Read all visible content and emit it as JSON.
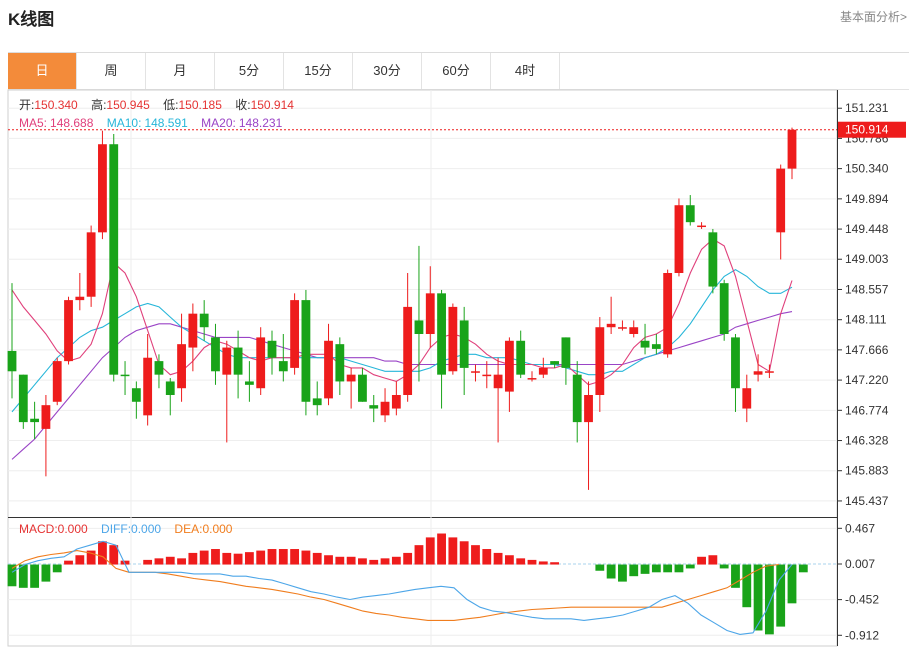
{
  "header": {
    "title": "K线图",
    "link": "基本面分析>"
  },
  "tabs": [
    {
      "label": "日"
    },
    {
      "label": "周"
    },
    {
      "label": "月"
    },
    {
      "label": "5分"
    },
    {
      "label": "15分"
    },
    {
      "label": "30分"
    },
    {
      "label": "60分"
    },
    {
      "label": "4时"
    }
  ],
  "active_tab": "日",
  "info": {
    "open_label": "开:",
    "open": "150.340",
    "high_label": "高:",
    "high": "150.945",
    "low_label": "低:",
    "low": "150.185",
    "close_label": "收:",
    "close": "150.914",
    "ma5_label": "MA5:",
    "ma5": "148.688",
    "ma10_label": "MA10:",
    "ma10": "148.591",
    "ma20_label": "MA20:",
    "ma20": "148.231"
  },
  "macd_info": {
    "macd_label": "MACD:",
    "macd": "0.000",
    "diff_label": "DIFF:",
    "diff": "0.000",
    "dea_label": "DEA:",
    "dea": "0.000"
  },
  "colors": {
    "up": "#ee1c1c",
    "down": "#19a319",
    "ma5": "#e0407b",
    "ma10": "#27b6d9",
    "ma20": "#9a44c6",
    "diff": "#4da6e8",
    "dea": "#f07d1e",
    "accent": "#f38b3a"
  },
  "chart_data": [
    {
      "type": "candlestick",
      "ylim": [
        145.2,
        151.5
      ],
      "y_ticks": [
        "151.231",
        "150.786",
        "150.340",
        "149.894",
        "149.448",
        "149.003",
        "148.557",
        "148.111",
        "147.666",
        "147.220",
        "146.774",
        "146.328",
        "145.883",
        "145.437"
      ],
      "last_price": "150.914",
      "candles": [
        [
          147.65,
          147.35,
          148.65,
          146.95
        ],
        [
          147.3,
          146.6,
          147.3,
          146.5
        ],
        [
          146.65,
          146.6,
          146.9,
          146.35
        ],
        [
          146.5,
          146.85,
          147.0,
          145.8
        ],
        [
          146.9,
          147.5,
          147.55,
          146.85
        ],
        [
          147.5,
          148.4,
          148.45,
          147.45
        ],
        [
          148.4,
          148.45,
          148.8,
          148.25
        ],
        [
          148.45,
          149.4,
          149.5,
          148.3
        ],
        [
          149.4,
          150.7,
          150.9,
          149.3
        ],
        [
          150.7,
          147.3,
          150.85,
          147.2
        ],
        [
          147.3,
          147.28,
          147.5,
          147.0
        ],
        [
          147.1,
          146.9,
          147.2,
          146.65
        ],
        [
          146.7,
          147.55,
          147.9,
          146.55
        ],
        [
          147.5,
          147.3,
          147.6,
          147.1
        ],
        [
          147.2,
          147.0,
          147.25,
          146.7
        ],
        [
          147.1,
          147.75,
          148.2,
          146.9
        ],
        [
          147.7,
          148.2,
          148.35,
          147.35
        ],
        [
          148.2,
          148.0,
          148.4,
          147.8
        ],
        [
          147.85,
          147.35,
          148.05,
          147.15
        ],
        [
          147.3,
          147.7,
          147.8,
          146.3
        ],
        [
          147.7,
          147.3,
          147.95,
          146.95
        ],
        [
          147.2,
          147.15,
          147.5,
          146.9
        ],
        [
          147.1,
          147.85,
          148.0,
          147.0
        ],
        [
          147.8,
          147.55,
          147.95,
          147.3
        ],
        [
          147.5,
          147.35,
          147.9,
          147.2
        ],
        [
          147.4,
          148.4,
          148.5,
          147.3
        ],
        [
          148.4,
          146.9,
          148.55,
          146.7
        ],
        [
          146.95,
          146.85,
          147.2,
          146.7
        ],
        [
          146.95,
          147.8,
          148.05,
          146.85
        ],
        [
          147.75,
          147.2,
          147.85,
          147.0
        ],
        [
          147.2,
          147.3,
          147.4,
          146.8
        ],
        [
          147.3,
          146.9,
          147.4,
          146.9
        ],
        [
          146.85,
          146.8,
          147.0,
          146.6
        ],
        [
          146.7,
          146.9,
          147.1,
          146.6
        ],
        [
          146.8,
          147.0,
          147.2,
          146.7
        ],
        [
          147.0,
          148.3,
          148.8,
          146.9
        ],
        [
          148.1,
          147.9,
          149.2,
          147.2
        ],
        [
          147.9,
          148.5,
          148.9,
          147.7
        ],
        [
          148.5,
          147.3,
          148.55,
          146.8
        ],
        [
          147.35,
          148.3,
          148.35,
          147.3
        ],
        [
          148.1,
          147.4,
          148.3,
          147.0
        ],
        [
          147.35,
          147.35,
          147.45,
          147.2
        ],
        [
          147.3,
          147.3,
          147.5,
          147.1
        ],
        [
          147.1,
          147.3,
          147.55,
          146.3
        ],
        [
          147.05,
          147.8,
          147.85,
          146.75
        ],
        [
          147.8,
          147.3,
          147.95,
          147.25
        ],
        [
          147.25,
          147.25,
          147.35,
          147.2
        ],
        [
          147.3,
          147.4,
          147.55,
          147.25
        ],
        [
          147.5,
          147.45,
          147.5,
          147.4
        ],
        [
          147.85,
          147.4,
          147.85,
          147.15
        ],
        [
          147.3,
          146.6,
          147.5,
          146.3
        ],
        [
          146.6,
          147.0,
          147.2,
          145.6
        ],
        [
          147.0,
          148.0,
          148.15,
          146.75
        ],
        [
          148.0,
          148.05,
          148.45,
          147.9
        ],
        [
          148.0,
          148.0,
          148.1,
          147.95
        ],
        [
          147.9,
          148.0,
          148.1,
          147.85
        ],
        [
          147.8,
          147.7,
          148.05,
          147.6
        ],
        [
          147.75,
          147.68,
          147.9,
          147.6
        ],
        [
          147.6,
          148.8,
          148.85,
          147.55
        ],
        [
          148.8,
          149.8,
          149.9,
          148.75
        ],
        [
          149.8,
          149.55,
          149.95,
          149.5
        ],
        [
          149.5,
          149.5,
          149.55,
          149.45
        ],
        [
          149.4,
          148.6,
          149.45,
          148.5
        ],
        [
          148.65,
          147.9,
          148.7,
          147.8
        ],
        [
          147.85,
          147.1,
          147.9,
          146.75
        ],
        [
          146.8,
          147.1,
          147.3,
          146.6
        ],
        [
          147.3,
          147.35,
          147.6,
          147.2
        ],
        [
          147.35,
          147.35,
          147.45,
          147.25
        ],
        [
          149.4,
          150.34,
          150.4,
          149.0
        ],
        [
          150.34,
          150.914,
          150.945,
          150.185
        ]
      ],
      "ma5": [
        148.55,
        148.3,
        148.1,
        147.9,
        147.65,
        147.5,
        147.55,
        147.75,
        148.2,
        148.95,
        148.8,
        148.45,
        147.95,
        147.45,
        147.3,
        147.35,
        147.5,
        147.7,
        147.8,
        147.75,
        147.65,
        147.55,
        147.5,
        147.55,
        147.55,
        147.55,
        147.6,
        147.6,
        147.6,
        147.45,
        147.4,
        147.4,
        147.3,
        147.25,
        147.2,
        147.3,
        147.45,
        147.7,
        147.85,
        147.9,
        147.85,
        147.75,
        147.6,
        147.5,
        147.45,
        147.45,
        147.45,
        147.4,
        147.4,
        147.45,
        147.3,
        147.15,
        147.2,
        147.3,
        147.45,
        147.7,
        147.85,
        147.9,
        148.0,
        148.35,
        148.8,
        149.15,
        149.3,
        149.2,
        148.75,
        148.1,
        147.45,
        147.35,
        148.2,
        148.69
      ],
      "ma10": [
        146.75,
        146.95,
        147.15,
        147.35,
        147.55,
        147.7,
        147.85,
        147.95,
        148.0,
        148.1,
        148.2,
        148.3,
        148.35,
        148.3,
        148.15,
        148.0,
        147.9,
        147.8,
        147.7,
        147.6,
        147.55,
        147.55,
        147.55,
        147.55,
        147.55,
        147.55,
        147.55,
        147.55,
        147.55,
        147.55,
        147.5,
        147.45,
        147.4,
        147.35,
        147.35,
        147.35,
        147.35,
        147.4,
        147.5,
        147.55,
        147.6,
        147.6,
        147.55,
        147.55,
        147.55,
        147.5,
        147.45,
        147.45,
        147.45,
        147.4,
        147.35,
        147.3,
        147.3,
        147.35,
        147.35,
        147.45,
        147.55,
        147.6,
        147.7,
        147.85,
        148.05,
        148.3,
        148.55,
        148.75,
        148.85,
        148.75,
        148.6,
        148.5,
        148.5,
        148.59
      ],
      "ma20": [
        146.05,
        146.2,
        146.35,
        146.55,
        146.75,
        146.95,
        147.15,
        147.35,
        147.55,
        147.7,
        147.85,
        147.95,
        148.0,
        148.05,
        148.05,
        148.0,
        147.95,
        147.9,
        147.85,
        147.85,
        147.85,
        147.85,
        147.8,
        147.75,
        147.7,
        147.65,
        147.6,
        147.55,
        147.55,
        147.55,
        147.55,
        147.55,
        147.55,
        147.5,
        147.5,
        147.45,
        147.45,
        147.45,
        147.45,
        147.45,
        147.45,
        147.45,
        147.45,
        147.45,
        147.45,
        147.45,
        147.45,
        147.45,
        147.45,
        147.45,
        147.45,
        147.45,
        147.45,
        147.45,
        147.45,
        147.5,
        147.55,
        147.6,
        147.65,
        147.7,
        147.75,
        147.8,
        147.85,
        147.9,
        148.0,
        148.05,
        148.1,
        148.15,
        148.2,
        148.23
      ]
    },
    {
      "type": "macd",
      "ylim": [
        -1.05,
        0.6
      ],
      "y_ticks": [
        "0.467",
        "0.007",
        "-0.452",
        "-0.912"
      ],
      "macd": [
        -0.28,
        -0.3,
        -0.3,
        -0.22,
        -0.1,
        0.05,
        0.12,
        0.18,
        0.3,
        0.25,
        0.05,
        0.0,
        0.06,
        0.08,
        0.1,
        0.08,
        0.15,
        0.18,
        0.2,
        0.15,
        0.14,
        0.16,
        0.18,
        0.2,
        0.2,
        0.2,
        0.18,
        0.15,
        0.12,
        0.1,
        0.1,
        0.08,
        0.06,
        0.08,
        0.1,
        0.15,
        0.25,
        0.35,
        0.4,
        0.35,
        0.3,
        0.25,
        0.2,
        0.15,
        0.12,
        0.08,
        0.06,
        0.04,
        0.03,
        0.0,
        0.0,
        0.0,
        -0.08,
        -0.18,
        -0.22,
        -0.15,
        -0.12,
        -0.1,
        -0.1,
        -0.1,
        -0.05,
        0.1,
        0.12,
        -0.05,
        -0.3,
        -0.55,
        -0.85,
        -0.9,
        -0.8,
        -0.5,
        -0.1,
        0.0
      ],
      "diff": [
        -0.1,
        0.0,
        0.05,
        0.08,
        0.1,
        0.2,
        0.25,
        0.3,
        0.25,
        -0.1,
        -0.1,
        -0.1,
        -0.1,
        -0.1,
        -0.12,
        -0.12,
        -0.12,
        -0.15,
        -0.15,
        -0.18,
        -0.2,
        -0.25,
        -0.3,
        -0.35,
        -0.38,
        -0.42,
        -0.45,
        -0.42,
        -0.4,
        -0.38,
        -0.35,
        -0.32,
        -0.3,
        -0.28,
        -0.3,
        -0.45,
        -0.55,
        -0.6,
        -0.62,
        -0.65,
        -0.68,
        -0.7,
        -0.7,
        -0.7,
        -0.72,
        -0.7,
        -0.68,
        -0.65,
        -0.6,
        -0.55,
        -0.45,
        -0.4,
        -0.5,
        -0.65,
        -0.75,
        -0.85,
        -0.9,
        -0.88,
        -0.6,
        -0.2,
        0.0
      ],
      "dea": [
        -0.05,
        0.05,
        0.1,
        0.13,
        0.15,
        0.18,
        0.15,
        0.1,
        -0.05,
        -0.1,
        -0.1,
        -0.1,
        -0.12,
        -0.15,
        -0.18,
        -0.2,
        -0.22,
        -0.25,
        -0.28,
        -0.3,
        -0.32,
        -0.35,
        -0.38,
        -0.42,
        -0.45,
        -0.5,
        -0.55,
        -0.6,
        -0.63,
        -0.65,
        -0.68,
        -0.7,
        -0.72,
        -0.72,
        -0.72,
        -0.7,
        -0.68,
        -0.65,
        -0.62,
        -0.6,
        -0.58,
        -0.57,
        -0.56,
        -0.55,
        -0.55,
        -0.55,
        -0.55,
        -0.55,
        -0.55,
        -0.55,
        -0.55,
        -0.5,
        -0.45,
        -0.4,
        -0.35,
        -0.3,
        -0.2,
        -0.1,
        -0.02,
        0.0
      ]
    }
  ]
}
